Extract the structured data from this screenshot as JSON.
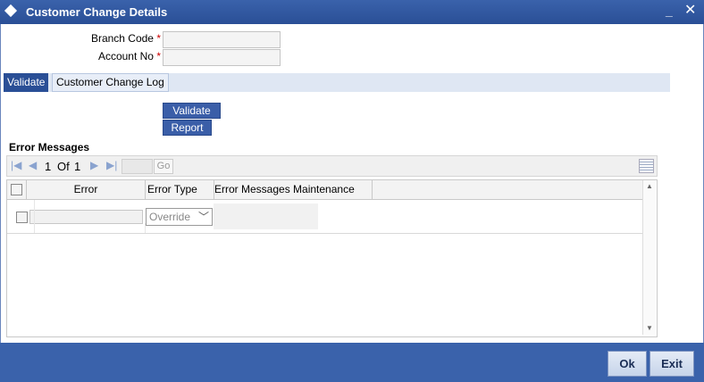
{
  "window": {
    "title": "Customer Change Details",
    "minimize_label": "_",
    "close_label": "✕"
  },
  "form": {
    "branch_code_label": "Branch Code",
    "account_no_label": "Account No",
    "required_mark": "*",
    "branch_code_value": "",
    "account_no_value": ""
  },
  "tabs": [
    {
      "label": "Validate",
      "active": true
    },
    {
      "label": "Customer Change Log",
      "active": false
    }
  ],
  "actions": {
    "validate_label": "Validate",
    "report_label": "Report"
  },
  "errors": {
    "section_title": "Error Messages",
    "pager": {
      "current": "1",
      "of_label": "Of",
      "total": "1",
      "go_label": "Go"
    },
    "columns": [
      "Error",
      "Error Type",
      "Error Messages Maintenance"
    ],
    "rows": [
      {
        "error": "",
        "error_type": "Override",
        "maintenance": ""
      }
    ]
  },
  "footer": {
    "ok_label": "Ok",
    "exit_label": "Exit"
  },
  "colors": {
    "titlebar": "#2a4f96",
    "accent": "#3a62ab",
    "required": "#cc0000"
  }
}
